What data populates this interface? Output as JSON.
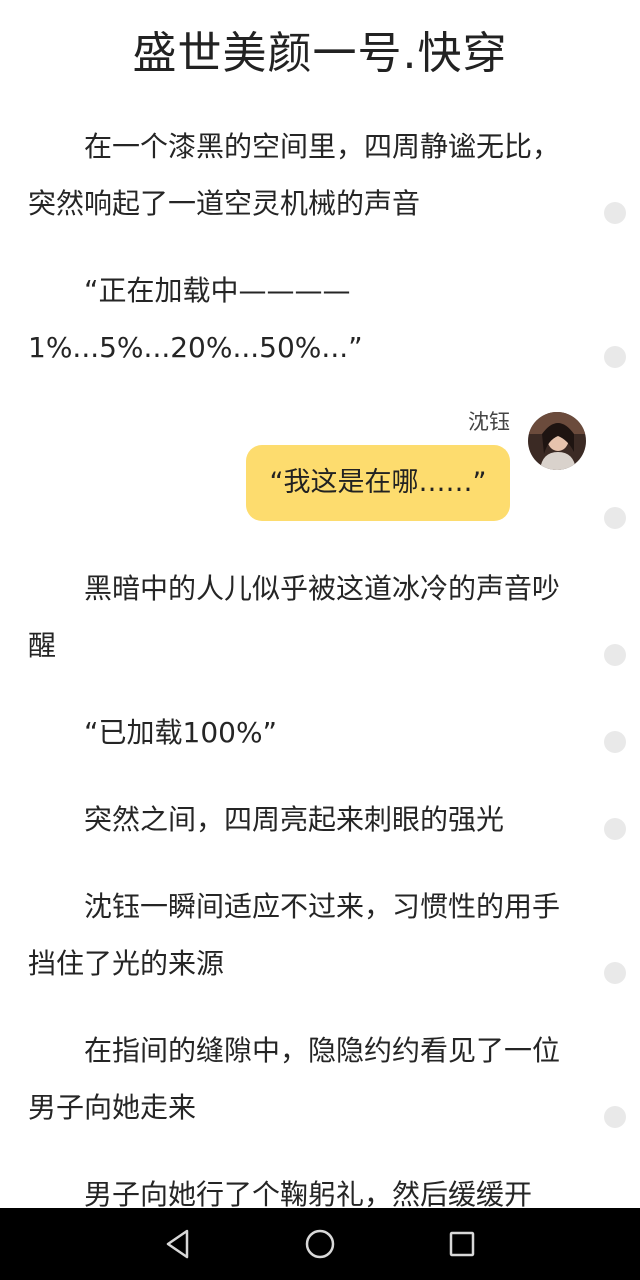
{
  "title": "盛世美颜一号.快穿",
  "paragraphs": [
    "在一个漆黑的空间里，四周静谧无比，突然响起了一道空灵机械的声音",
    "“正在加载中————1%...5%...20%...50%...”",
    "黑暗中的人儿似乎被这道冰冷的声音吵醒",
    "“已加载100%”",
    "突然之间，四周亮起来刺眼的强光",
    "沈钰一瞬间适应不过来，习惯性的用手挡住了光的来源",
    "在指间的缝隙中，隐隐约约看见了一位男子向她走来",
    "男子向她行了个鞠躬礼，然后缓缓开"
  ],
  "dialogue": {
    "speaker": "沈钰",
    "text": "“我这是在哪……”"
  },
  "colors": {
    "bubble": "#fddc6e",
    "navbar": "#000000",
    "dot": "#e9e9e9"
  },
  "navbar": {
    "back_icon": "triangle-back-icon",
    "home_icon": "circle-home-icon",
    "recents_icon": "square-recents-icon"
  }
}
